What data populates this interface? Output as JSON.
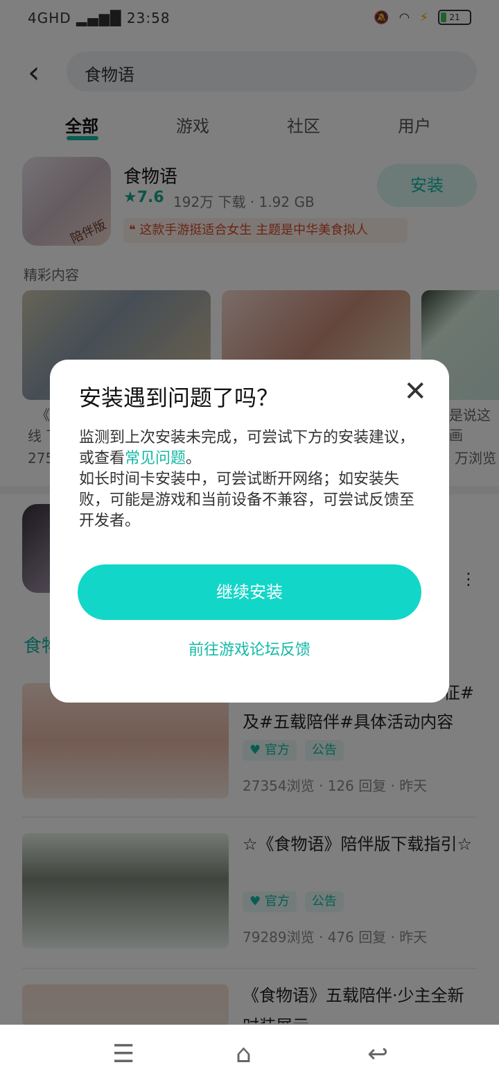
{
  "status": {
    "network": "4GHD",
    "signal": "▂▄▆█",
    "time": "23:58",
    "battery": "21"
  },
  "search": {
    "query": "食物语"
  },
  "tabs": [
    {
      "label": "全部"
    },
    {
      "label": "游戏"
    },
    {
      "label": "社区"
    },
    {
      "label": "用户"
    }
  ],
  "app": {
    "name": "食物语",
    "rating": "★7.6",
    "meta": "192万 下载 · 1.92 GB",
    "tagline": "❝ 这款手游挺适合女生 主题是中华美食拟人",
    "install_label": "安装",
    "icon_badge": "陪伴版"
  },
  "highlights": {
    "label": "精彩内容",
    "peeks": [
      "《",
      "线 下",
      "275",
      "是说这画",
      "万浏览"
    ]
  },
  "section2": {
    "label": "食物"
  },
  "posts": [
    {
      "title_partial": "及#五载陪伴#具体活动内容",
      "title_tail": "征#",
      "chips": [
        "官方",
        "公告"
      ],
      "meta": "27354浏览 · 126 回复 · 昨天"
    },
    {
      "title": "☆《食物语》陪伴版下载指引☆",
      "chips": [
        "官方",
        "公告"
      ],
      "meta": "79289浏览 · 476 回复 · 昨天"
    },
    {
      "title": "《食物语》五载陪伴·少主全新时装展示"
    }
  ],
  "dialog": {
    "title": "安装遇到问题了吗？",
    "body_1": "监测到上次安装未完成，可尝试下方的安装建议，或查看",
    "body_link": "常见问题",
    "body_1_end": "。",
    "body_2": "如长时间卡安装中，可尝试断开网络；如安装失败，可能是游戏和当前设备不兼容，可尝试反馈至开发者。",
    "continue_label": "继续安装",
    "forum_label": "前往游戏论坛反馈",
    "close": "✕"
  },
  "nav": {
    "menu": "☰",
    "home": "⌂",
    "back": "↩"
  },
  "colors": {
    "accent": "#14b9a6",
    "button": "#12d6c8",
    "overlay": "rgba(0,0,0,0.5)"
  }
}
